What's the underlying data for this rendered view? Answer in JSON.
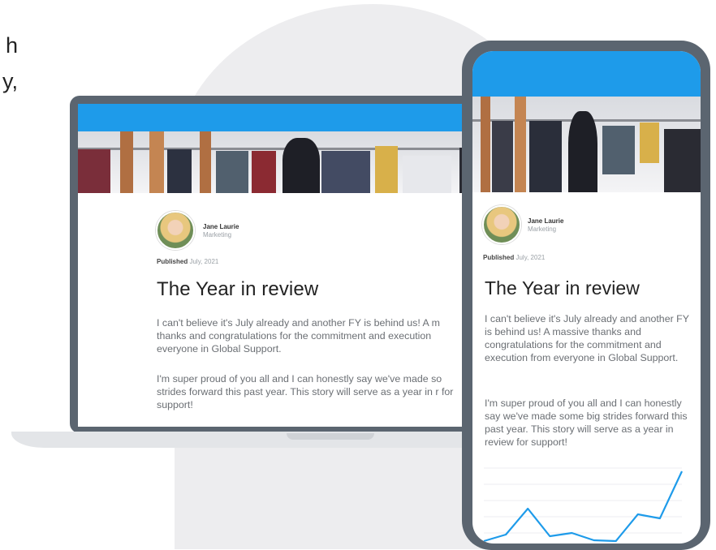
{
  "side_text": {
    "line1": "h",
    "line2": "y,"
  },
  "article": {
    "author_name": "Jane Laurie",
    "author_role": "Marketing",
    "published_label": "Published",
    "published_date": "July, 2021",
    "title": "The Year in review",
    "laptop_paragraph1": "I can't believe it's July already and another FY is behind us! A m thanks and congratulations for the commitment and execution everyone in Global Support.",
    "laptop_paragraph2": "I'm super proud of you all and I can honestly say we've made so strides forward this past year. This story will serve as a year in r for support!",
    "phone_paragraph1": "I can't believe it's July already and another FY is behind us! A massive thanks and congratulations for the commitment and execution from everyone in Global Support.",
    "phone_paragraph2": "I'm super proud of you all and I can honestly say we've made some big strides forward this past year. This story will serve as a year in review for support!"
  },
  "colors": {
    "header_blue": "#1e9bea",
    "device_frame": "#5b6570",
    "chart_line": "#1e9bea"
  },
  "chart_data": {
    "type": "line",
    "x": [
      0,
      1,
      2,
      3,
      4,
      5,
      6,
      7,
      8,
      9
    ],
    "values": [
      2,
      10,
      42,
      8,
      12,
      3,
      2,
      35,
      30,
      88
    ],
    "ylim": [
      0,
      100
    ],
    "grid": true
  }
}
